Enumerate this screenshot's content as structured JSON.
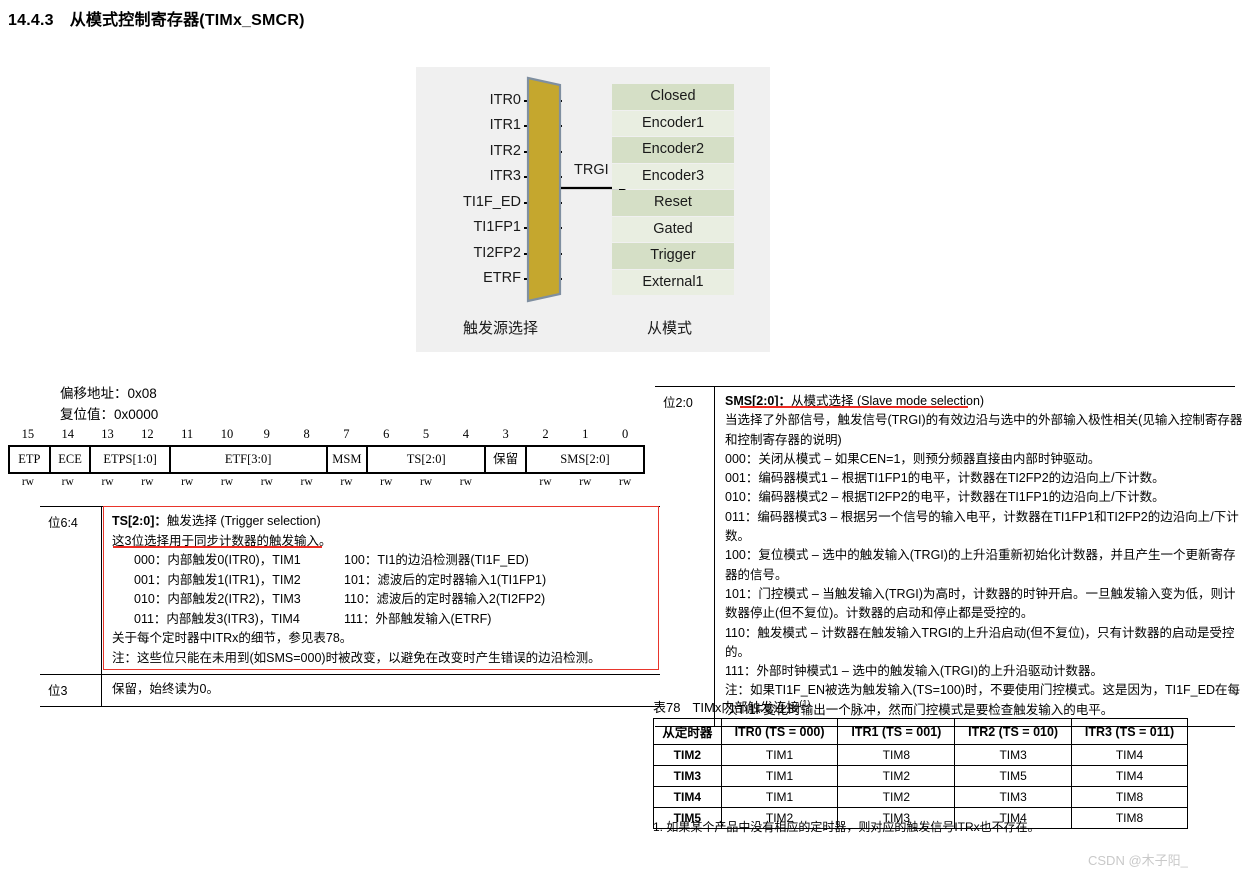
{
  "section": {
    "number": "14.4.3",
    "title": "从模式控制寄存器(TIMx_SMCR)"
  },
  "diagram": {
    "inputs": [
      "ITR0",
      "ITR1",
      "ITR2",
      "ITR3",
      "TI1F_ED",
      "TI1FP1",
      "TI2FP2",
      "ETRF"
    ],
    "mux_output_label": "TRGI",
    "slave_modes": [
      "Closed",
      "Encoder1",
      "Encoder2",
      "Encoder3",
      "Reset",
      "Gated",
      "Trigger",
      "External1"
    ],
    "caption_left": "触发源选择",
    "caption_right": "从模式",
    "colors": {
      "background": "#f0f0f0",
      "mux_fill": "#c5a72e",
      "mux_stroke": "#7f8fa0",
      "mode_dark": "#d5dfc6",
      "mode_light": "#e9eee1",
      "annotation_red": "#ee2b22"
    }
  },
  "register": {
    "offset_label": "偏移地址：0x08",
    "reset_label": "复位值：0x0000",
    "bit_numbers": [
      "15",
      "14",
      "13",
      "12",
      "11",
      "10",
      "9",
      "8",
      "7",
      "6",
      "5",
      "4",
      "3",
      "2",
      "1",
      "0"
    ],
    "fields": [
      {
        "name": "ETP",
        "span": 1
      },
      {
        "name": "ECE",
        "span": 1
      },
      {
        "name": "ETPS[1:0]",
        "span": 2
      },
      {
        "name": "ETF[3:0]",
        "span": 4
      },
      {
        "name": "MSM",
        "span": 1
      },
      {
        "name": "TS[2:0]",
        "span": 3
      },
      {
        "name": "保留",
        "span": 1
      },
      {
        "name": "SMS[2:0]",
        "span": 3
      }
    ],
    "access": [
      "rw",
      "rw",
      "rw",
      "rw",
      "rw",
      "rw",
      "rw",
      "rw",
      "rw",
      "rw",
      "rw",
      "rw",
      "",
      "rw",
      "rw",
      "rw"
    ]
  },
  "ts_field": {
    "bits": "位6:4",
    "title_bold": "TS[2:0]：",
    "title_rest": "触发选择 (Trigger selection)",
    "subtitle": "这3位选择用于同步计数器的触发输入。",
    "options": [
      {
        "left": "000：内部触发0(ITR0)，TIM1",
        "right": "100：TI1的边沿检测器(TI1F_ED)"
      },
      {
        "left": "001：内部触发1(ITR1)，TIM2",
        "right": "101：滤波后的定时器输入1(TI1FP1)"
      },
      {
        "left": "010：内部触发2(ITR2)，TIM3",
        "right": "110：滤波后的定时器输入2(TI2FP2)"
      },
      {
        "left": "011：内部触发3(ITR3)，TIM4",
        "right": "111：外部触发输入(ETRF)"
      }
    ],
    "note1": "关于每个定时器中ITRx的细节，参见表78。",
    "note2": "注：这些位只能在未用到(如SMS=000)时被改变，以避免在改变时产生错误的边沿检测。"
  },
  "reserved_field": {
    "bits": "位3",
    "text": "保留，始终读为0。"
  },
  "sms_field": {
    "bits": "位2:0",
    "title_bold": "SMS[2:0]：",
    "title_rest": "从模式选择 (Slave mode selection)",
    "intro_line1": "当选择了外部信号，触发信号(TRGI)的有效边沿与选中的外部输入极性相关(见输入控制寄存器",
    "intro_line2": "和控制寄存器的说明)",
    "options": [
      "000：关闭从模式 – 如果CEN=1，则预分频器直接由内部时钟驱动。",
      "001：编码器模式1 – 根据TI1FP1的电平，计数器在TI2FP2的边沿向上/下计数。",
      "010：编码器模式2 – 根据TI2FP2的电平，计数器在TI1FP1的边沿向上/下计数。",
      "011：编码器模式3 – 根据另一个信号的输入电平，计数器在TI1FP1和TI2FP2的边沿向上/下计数。",
      "100：复位模式 – 选中的触发输入(TRGI)的上升沿重新初始化计数器，并且产生一个更新寄存器的信号。",
      "101：门控模式 – 当触发输入(TRGI)为高时，计数器的时钟开启。一旦触发输入变为低，则计数器停止(但不复位)。计数器的启动和停止都是受控的。",
      "110：触发模式 – 计数器在触发输入TRGI的上升沿启动(但不复位)，只有计数器的启动是受控的。",
      "111：外部时钟模式1 – 选中的触发输入(TRGI)的上升沿驱动计数器。"
    ],
    "note": "注：如果TI1F_EN被选为触发输入(TS=100)时，不要使用门控模式。这是因为，TI1F_ED在每次TI1F变化时输出一个脉冲，然而门控模式是要检查触发输入的电平。"
  },
  "table78": {
    "caption_number": "表78",
    "caption_text": "TIMx内部触发连接",
    "caption_superscript": "(1)",
    "headers": [
      "从定时器",
      "ITR0 (TS = 000)",
      "ITR1 (TS = 001)",
      "ITR2 (TS = 010)",
      "ITR3 (TS = 011)"
    ],
    "rows": [
      [
        "TIM2",
        "TIM1",
        "TIM8",
        "TIM3",
        "TIM4"
      ],
      [
        "TIM3",
        "TIM1",
        "TIM2",
        "TIM5",
        "TIM4"
      ],
      [
        "TIM4",
        "TIM1",
        "TIM2",
        "TIM3",
        "TIM8"
      ],
      [
        "TIM5",
        "TIM2",
        "TIM3",
        "TIM4",
        "TIM8"
      ]
    ],
    "footnote": "1. 如果某个产品中没有相应的定时器，则对应的触发信号ITRx也不存在。"
  },
  "watermark": "CSDN @木子阳_"
}
